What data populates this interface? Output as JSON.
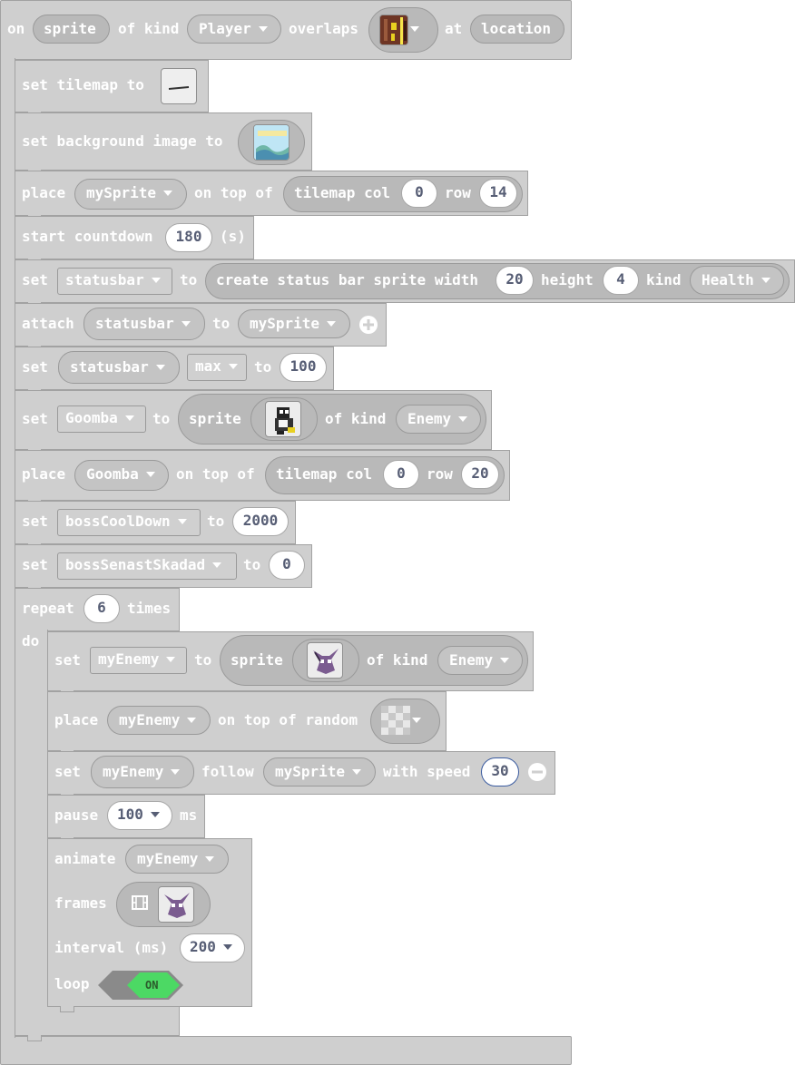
{
  "event": {
    "on": "on",
    "sprite": "sprite",
    "of_kind": "of kind",
    "kind": "Player",
    "overlaps": "overlaps",
    "at": "at",
    "location": "location"
  },
  "tilemap": {
    "label": "set tilemap to"
  },
  "background": {
    "label": "set background image to"
  },
  "place1": {
    "place": "place",
    "sprite": "mySprite",
    "on_top_of": "on top of",
    "tilemap_col": "tilemap col",
    "col": "0",
    "row": "row",
    "row_val": "14"
  },
  "countdown": {
    "label": "start countdown",
    "value": "180",
    "unit": "(s)"
  },
  "statusbar_create": {
    "set": "set",
    "var": "statusbar",
    "to": "to",
    "create": "create status bar sprite width",
    "width": "20",
    "height_label": "height",
    "height": "4",
    "kind_label": "kind",
    "kind": "Health"
  },
  "attach": {
    "attach": "attach",
    "var": "statusbar",
    "to": "to",
    "target": "mySprite"
  },
  "statusbar_max": {
    "set": "set",
    "var": "statusbar",
    "field": "max",
    "to": "to",
    "value": "100"
  },
  "goomba_set": {
    "set": "set",
    "var": "Goomba",
    "to": "to",
    "sprite": "sprite",
    "of_kind": "of kind",
    "kind": "Enemy"
  },
  "place2": {
    "place": "place",
    "sprite": "Goomba",
    "on_top_of": "on top of",
    "tilemap_col": "tilemap col",
    "col": "0",
    "row": "row",
    "row_val": "20"
  },
  "boss_cooldown": {
    "set": "set",
    "var": "bossCoolDown",
    "to": "to",
    "value": "2000"
  },
  "boss_damage": {
    "set": "set",
    "var": "bossSenastSkadad",
    "to": "to",
    "value": "0"
  },
  "repeat": {
    "repeat": "repeat",
    "count": "6",
    "times": "times",
    "do": "do"
  },
  "enemy_set": {
    "set": "set",
    "var": "myEnemy",
    "to": "to",
    "sprite": "sprite",
    "of_kind": "of kind",
    "kind": "Enemy"
  },
  "enemy_place": {
    "place": "place",
    "var": "myEnemy",
    "label": "on top of random"
  },
  "enemy_follow": {
    "set": "set",
    "var": "myEnemy",
    "follow": "follow",
    "target": "mySprite",
    "with_speed": "with speed",
    "speed": "30"
  },
  "pause": {
    "label": "pause",
    "value": "100",
    "unit": "ms"
  },
  "animate": {
    "animate": "animate",
    "var": "myEnemy",
    "frames": "frames",
    "interval": "interval (ms)",
    "interval_value": "200",
    "loop": "loop",
    "toggle": "ON"
  },
  "colors": {
    "block": "#cfcfcf",
    "border": "#a2a2a2",
    "toggle_on": "#4cd964",
    "value_text": "#575e75"
  }
}
